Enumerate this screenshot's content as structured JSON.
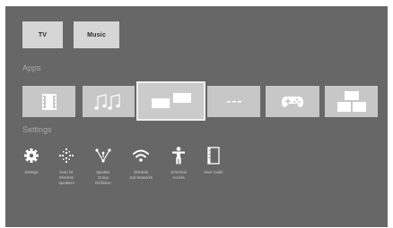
{
  "top_row": {
    "tv_label": "TV",
    "music_label": "Music"
  },
  "apps": {
    "section_title": "Apps",
    "items": [
      {
        "icon": "film-icon"
      },
      {
        "icon": "music-notes-icon"
      },
      {
        "icon": "screens-icon",
        "focused": true
      },
      {
        "icon": "dots-icon"
      },
      {
        "icon": "gamepad-icon"
      },
      {
        "icon": "tiles-icon"
      }
    ]
  },
  "settings": {
    "section_title": "Settings",
    "items": [
      {
        "label": "Settings",
        "icon": "gear-icon"
      },
      {
        "label": "Scan for\nWireless\nSpeakers",
        "icon": "scan-dots-icon"
      },
      {
        "label": "Speaker\nGroup\nDefinition",
        "icon": "speaker-group-icon"
      },
      {
        "label": "Wireless\nand Networks",
        "icon": "wifi-icon"
      },
      {
        "label": "Universal\nAccess",
        "icon": "accessibility-icon"
      },
      {
        "label": "User Guide",
        "icon": "book-icon"
      }
    ]
  },
  "colors": {
    "background": "#676767",
    "tile": "#d6d6d6",
    "icon_white": "#ffffff",
    "section_text": "#a9a9a9"
  }
}
